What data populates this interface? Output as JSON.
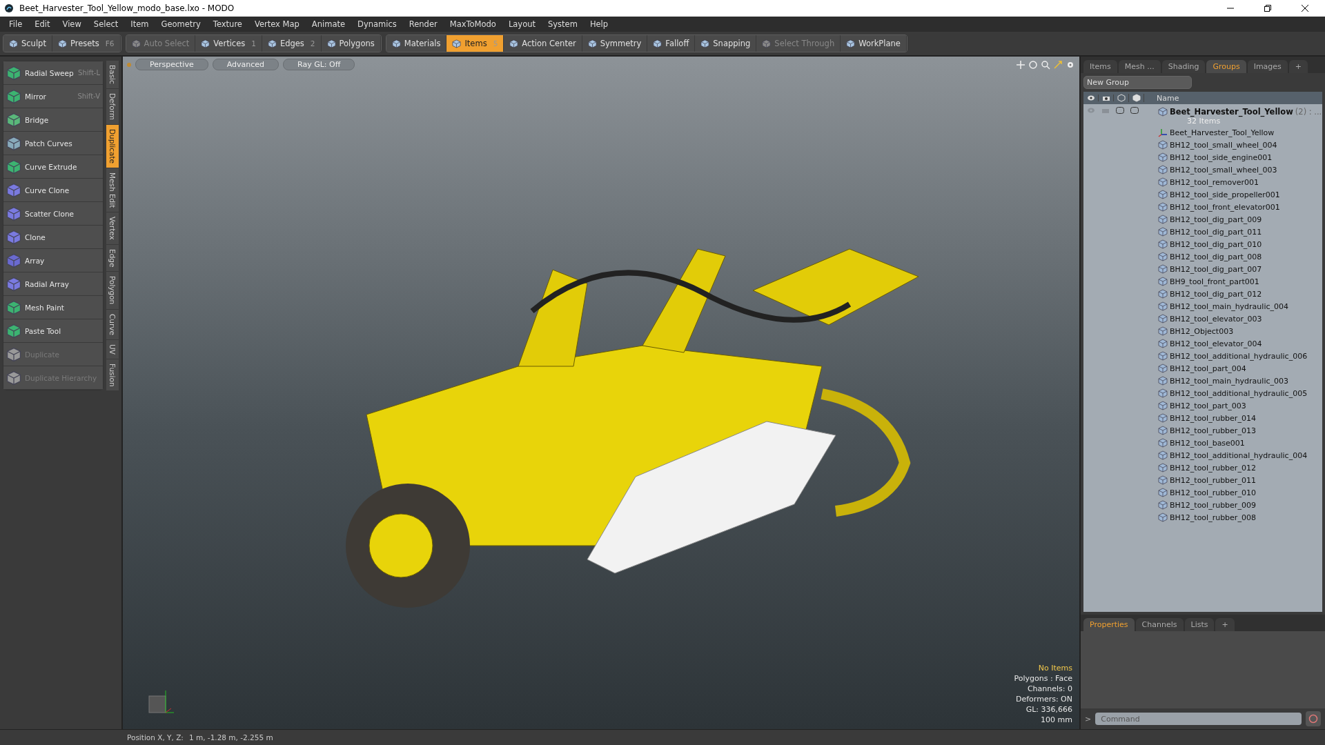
{
  "window": {
    "title": "Beet_Harvester_Tool_Yellow_modo_base.lxo - MODO"
  },
  "menu": [
    "File",
    "Edit",
    "View",
    "Select",
    "Item",
    "Geometry",
    "Texture",
    "Vertex Map",
    "Animate",
    "Dynamics",
    "Render",
    "MaxToModo",
    "Layout",
    "System",
    "Help"
  ],
  "toolbar_groups": [
    [
      {
        "label": "Sculpt",
        "selected": false,
        "disabled": false
      },
      {
        "label": "Presets",
        "key": "F6",
        "selected": false,
        "disabled": false
      }
    ],
    [
      {
        "label": "Auto Select",
        "selected": false,
        "disabled": true
      },
      {
        "label": "Vertices",
        "key": "1",
        "selected": false,
        "disabled": false
      },
      {
        "label": "Edges",
        "key": "2",
        "selected": false,
        "disabled": false
      },
      {
        "label": "Polygons",
        "selected": false,
        "disabled": false
      }
    ],
    [
      {
        "label": "Materials",
        "selected": false,
        "disabled": false
      },
      {
        "label": "Items",
        "key": "5",
        "selected": true,
        "disabled": false
      },
      {
        "label": "Action Center",
        "selected": false,
        "disabled": false
      },
      {
        "label": "Symmetry",
        "selected": false,
        "disabled": false
      },
      {
        "label": "Falloff",
        "selected": false,
        "disabled": false
      },
      {
        "label": "Snapping",
        "selected": false,
        "disabled": false
      },
      {
        "label": "Select Through",
        "selected": false,
        "disabled": true
      },
      {
        "label": "WorkPlane",
        "selected": false,
        "disabled": false
      }
    ]
  ],
  "tools": [
    {
      "label": "Radial Sweep",
      "shortcut": "Shift-L",
      "disabled": false
    },
    {
      "label": "Mirror",
      "shortcut": "Shift-V",
      "disabled": false
    },
    {
      "label": "Bridge",
      "disabled": false
    },
    {
      "label": "Patch Curves",
      "disabled": false
    },
    {
      "label": "Curve Extrude",
      "disabled": false
    },
    {
      "label": "Curve Clone",
      "disabled": false
    },
    {
      "label": "Scatter Clone",
      "disabled": false
    },
    {
      "label": "Clone",
      "disabled": false
    },
    {
      "label": "Array",
      "disabled": false
    },
    {
      "label": "Radial Array",
      "disabled": false
    },
    {
      "label": "Mesh Paint",
      "disabled": false
    },
    {
      "label": "Paste Tool",
      "disabled": false
    },
    {
      "label": "Duplicate",
      "disabled": true
    },
    {
      "label": "Duplicate Hierarchy",
      "disabled": true
    }
  ],
  "tool_tabs": [
    {
      "label": "Basic",
      "selected": false
    },
    {
      "label": "Deform",
      "selected": false
    },
    {
      "label": "Duplicate",
      "selected": true
    },
    {
      "label": "Mesh Edit",
      "selected": false
    },
    {
      "label": "Vertex",
      "selected": false
    },
    {
      "label": "Edge",
      "selected": false
    },
    {
      "label": "Polygon",
      "selected": false
    },
    {
      "label": "Curve",
      "selected": false
    },
    {
      "label": "UV",
      "selected": false
    },
    {
      "label": "Fusion",
      "selected": false
    }
  ],
  "viewport": {
    "tabs": [
      "Perspective",
      "Advanced",
      "Ray GL: Off"
    ],
    "info": [
      {
        "text": "No Items",
        "kind": "highlight"
      },
      {
        "text": "Polygons : Face",
        "kind": "plain"
      },
      {
        "text": "Channels: 0",
        "kind": "plain"
      },
      {
        "text": "Deformers: ON",
        "kind": "plain"
      },
      {
        "text": "GL: 336,666",
        "kind": "plain"
      },
      {
        "text": "100 mm",
        "kind": "plain"
      }
    ]
  },
  "scene_panel": {
    "tabs": [
      {
        "label": "Items",
        "selected": false
      },
      {
        "label": "Mesh ...",
        "selected": false
      },
      {
        "label": "Shading",
        "selected": false
      },
      {
        "label": "Groups",
        "selected": true
      },
      {
        "label": "Images",
        "selected": false
      },
      {
        "label": "+",
        "selected": false
      }
    ],
    "new_group": "New Group",
    "column": "Name",
    "group": {
      "name": "Beet_Harvester_Tool_Yellow",
      "count": "(2)",
      "more": ": ...",
      "items_count": "32 Items",
      "children": [
        {
          "name": "Beet_Harvester_Tool_Yellow",
          "kind": "locator"
        },
        {
          "name": "BH12_tool_small_wheel_004",
          "kind": "mesh"
        },
        {
          "name": "BH12_tool_side_engine001",
          "kind": "mesh"
        },
        {
          "name": "BH12_tool_small_wheel_003",
          "kind": "mesh"
        },
        {
          "name": "BH12_tool_remover001",
          "kind": "mesh"
        },
        {
          "name": "BH12_tool_side_propeller001",
          "kind": "mesh"
        },
        {
          "name": "BH12_tool_front_elevator001",
          "kind": "mesh"
        },
        {
          "name": "BH12_tool_dig_part_009",
          "kind": "mesh"
        },
        {
          "name": "BH12_tool_dig_part_011",
          "kind": "mesh"
        },
        {
          "name": "BH12_tool_dig_part_010",
          "kind": "mesh"
        },
        {
          "name": "BH12_tool_dig_part_008",
          "kind": "mesh"
        },
        {
          "name": "BH12_tool_dig_part_007",
          "kind": "mesh"
        },
        {
          "name": "BH9_tool_front_part001",
          "kind": "mesh"
        },
        {
          "name": "BH12_tool_dig_part_012",
          "kind": "mesh"
        },
        {
          "name": "BH12_tool_main_hydraulic_004",
          "kind": "mesh"
        },
        {
          "name": "BH12_tool_elevator_003",
          "kind": "mesh"
        },
        {
          "name": "BH12_Object003",
          "kind": "mesh"
        },
        {
          "name": "BH12_tool_elevator_004",
          "kind": "mesh"
        },
        {
          "name": "BH12_tool_additional_hydraulic_006",
          "kind": "mesh"
        },
        {
          "name": "BH12_tool_part_004",
          "kind": "mesh"
        },
        {
          "name": "BH12_tool_main_hydraulic_003",
          "kind": "mesh"
        },
        {
          "name": "BH12_tool_additional_hydraulic_005",
          "kind": "mesh"
        },
        {
          "name": "BH12_tool_part_003",
          "kind": "mesh"
        },
        {
          "name": "BH12_tool_rubber_014",
          "kind": "mesh"
        },
        {
          "name": "BH12_tool_rubber_013",
          "kind": "mesh"
        },
        {
          "name": "BH12_tool_base001",
          "kind": "mesh"
        },
        {
          "name": "BH12_tool_additional_hydraulic_004",
          "kind": "mesh"
        },
        {
          "name": "BH12_tool_rubber_012",
          "kind": "mesh"
        },
        {
          "name": "BH12_tool_rubber_011",
          "kind": "mesh"
        },
        {
          "name": "BH12_tool_rubber_010",
          "kind": "mesh"
        },
        {
          "name": "BH12_tool_rubber_009",
          "kind": "mesh"
        },
        {
          "name": "BH12_tool_rubber_008",
          "kind": "mesh"
        }
      ]
    }
  },
  "properties_panel": {
    "tabs": [
      {
        "label": "Properties",
        "selected": true
      },
      {
        "label": "Channels",
        "selected": false
      },
      {
        "label": "Lists",
        "selected": false
      },
      {
        "label": "+",
        "selected": false
      }
    ]
  },
  "command": {
    "prompt": ">",
    "placeholder": "Command"
  },
  "status_bar": {
    "label": "Position X, Y, Z:",
    "value": "1 m, -1.28 m, -2.255 m"
  }
}
